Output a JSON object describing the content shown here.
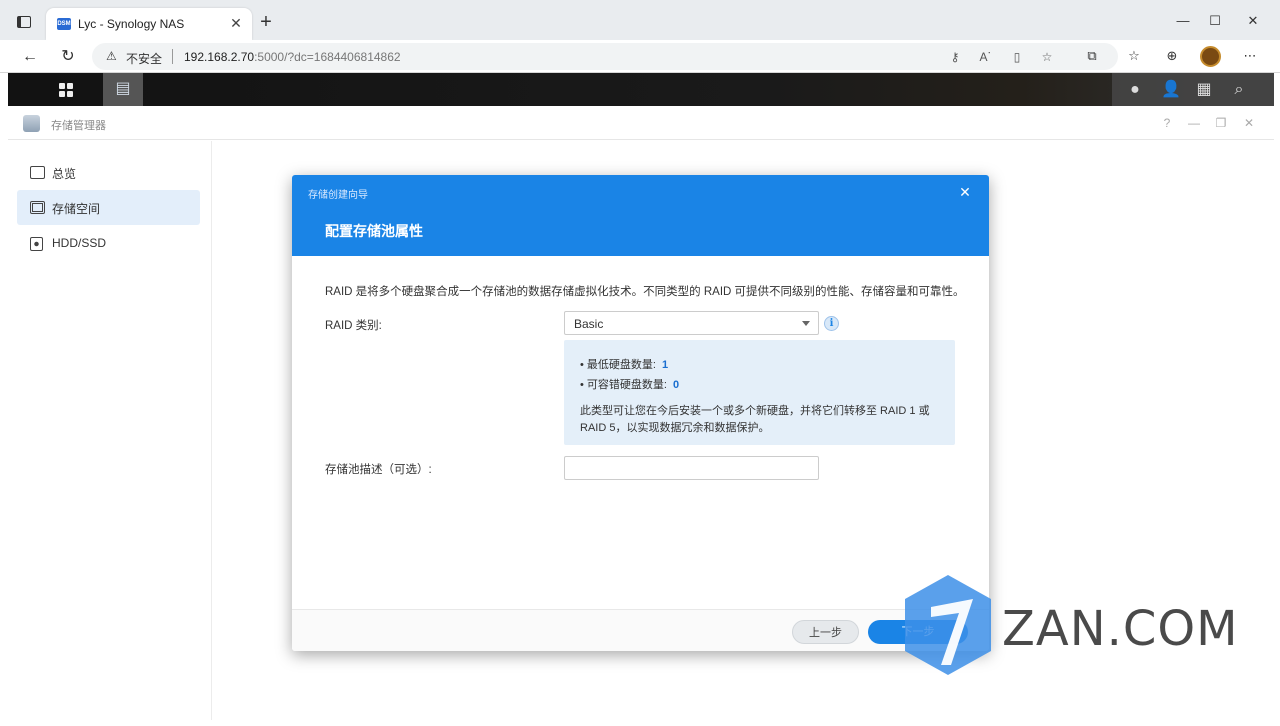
{
  "browser": {
    "tab_title": "Lyc - Synology NAS",
    "tab_favicon": "DSM",
    "tab_close": "✕",
    "new_tab": "+",
    "window_controls": {
      "minimize": "—",
      "maximize": "☐",
      "close": "✕"
    },
    "nav": {
      "back": "←",
      "reload": "↻"
    },
    "address": {
      "security_label": "不安全",
      "url_host": "192.168.2.70",
      "url_rest": ":5000/?dc=1684406814862"
    }
  },
  "app": {
    "title": "存储管理器",
    "header_controls": {
      "help": "?",
      "minimize": "—",
      "restore": "❐",
      "close": "✕"
    }
  },
  "sidebar": {
    "items": [
      {
        "label": "总览",
        "icon": "overview-icon",
        "active": false
      },
      {
        "label": "存储空间",
        "icon": "storage-icon",
        "active": true
      },
      {
        "label": "HDD/SSD",
        "icon": "disk-icon",
        "active": false
      }
    ]
  },
  "dialog": {
    "wizard_title": "存储创建向导",
    "step_title": "配置存储池属性",
    "close": "✕",
    "intro": "RAID 是将多个硬盘聚合成一个存储池的数据存储虚拟化技术。不同类型的 RAID 可提供不同级别的性能、存储容量和可靠性。",
    "raid_label": "RAID 类别:",
    "raid_value": "Basic",
    "info_glyph": "i",
    "info": {
      "min_disks_label": "最低硬盘数量:",
      "min_disks_value": "1",
      "fault_tolerance_label": "可容错硬盘数量:",
      "fault_tolerance_value": "0",
      "note_line1": "此类型可让您在今后安装一个或多个新硬盘，并将它们转移至 RAID 1 或",
      "note_line2": "RAID 5，以实现数据冗余和数据保护。"
    },
    "desc_label": "存储池描述（可选）:",
    "desc_value": "",
    "prev_button": "上一步",
    "next_button": "下一步"
  },
  "watermark": {
    "text": "ZAN.COM",
    "digit": "7"
  },
  "colors": {
    "accent": "#1a84e6",
    "info_bg": "#e4eff9",
    "sidebar_active": "#e3eefa"
  }
}
